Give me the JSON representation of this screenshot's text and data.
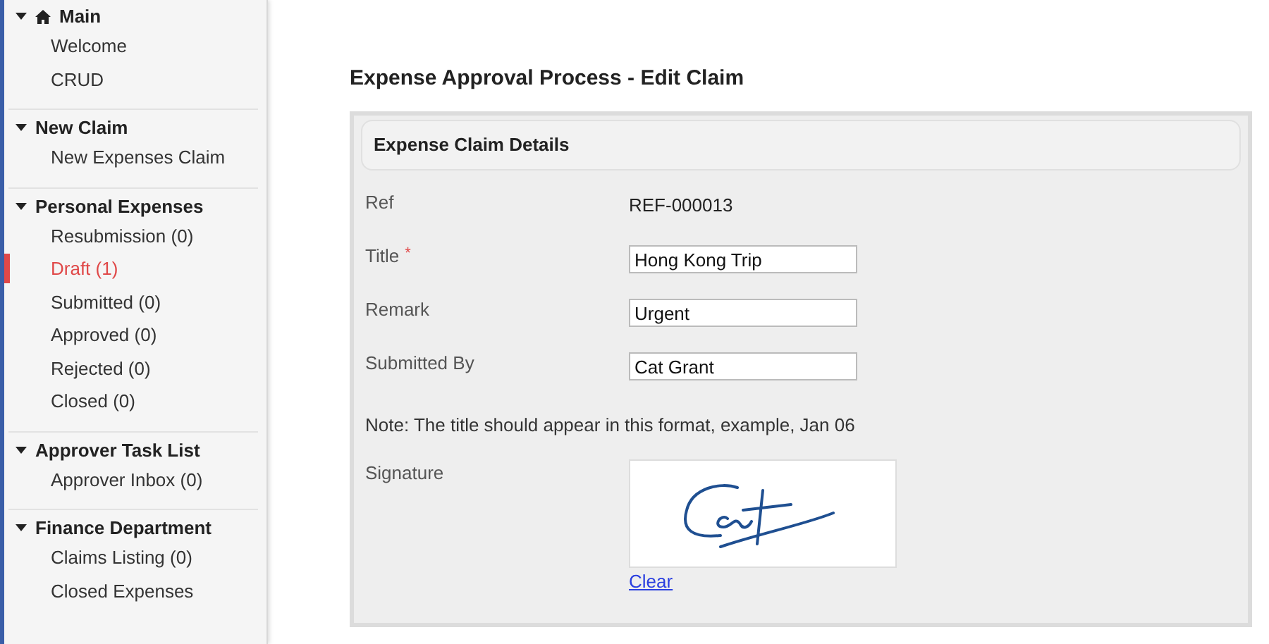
{
  "sidebar": {
    "sections": [
      {
        "title": "Main",
        "expanded": true,
        "items": [
          {
            "label": "Welcome",
            "selected": false
          },
          {
            "label": "CRUD",
            "selected": false
          }
        ]
      },
      {
        "title": "New Claim",
        "expanded": true,
        "items": [
          {
            "label": "New Expenses Claim",
            "selected": false
          }
        ]
      },
      {
        "title": "Personal Expenses",
        "expanded": true,
        "items": [
          {
            "label": "Resubmission (0)",
            "selected": false
          },
          {
            "label": "Draft (1)",
            "selected": true
          },
          {
            "label": "Submitted (0)",
            "selected": false
          },
          {
            "label": "Approved (0)",
            "selected": false
          },
          {
            "label": "Rejected (0)",
            "selected": false
          },
          {
            "label": "Closed (0)",
            "selected": false
          }
        ]
      },
      {
        "title": "Approver Task List",
        "expanded": true,
        "items": [
          {
            "label": "Approver Inbox (0)",
            "selected": false
          }
        ]
      },
      {
        "title": "Finance Department",
        "expanded": true,
        "items": [
          {
            "label": "Claims Listing (0)",
            "selected": false
          },
          {
            "label": "Closed Expenses",
            "selected": false
          }
        ]
      }
    ]
  },
  "page_title": "Expense Approval Process - Edit Claim",
  "panel": {
    "title": "Expense Claim Details",
    "fields": [
      {
        "label": "Ref",
        "kind": "text",
        "value": "REF-000013"
      },
      {
        "label": "Title",
        "kind": "input",
        "value": "Hong Kong Trip",
        "required_mark": "*"
      },
      {
        "label": "Remark",
        "kind": "input",
        "value": "Urgent"
      },
      {
        "label": "Submitted By",
        "kind": "input",
        "value": "Cat Grant"
      }
    ],
    "note": "Note: The title should appear in this format, example, Jan 06",
    "signature": {
      "label": "Signature",
      "clear_link": "Clear"
    }
  }
}
